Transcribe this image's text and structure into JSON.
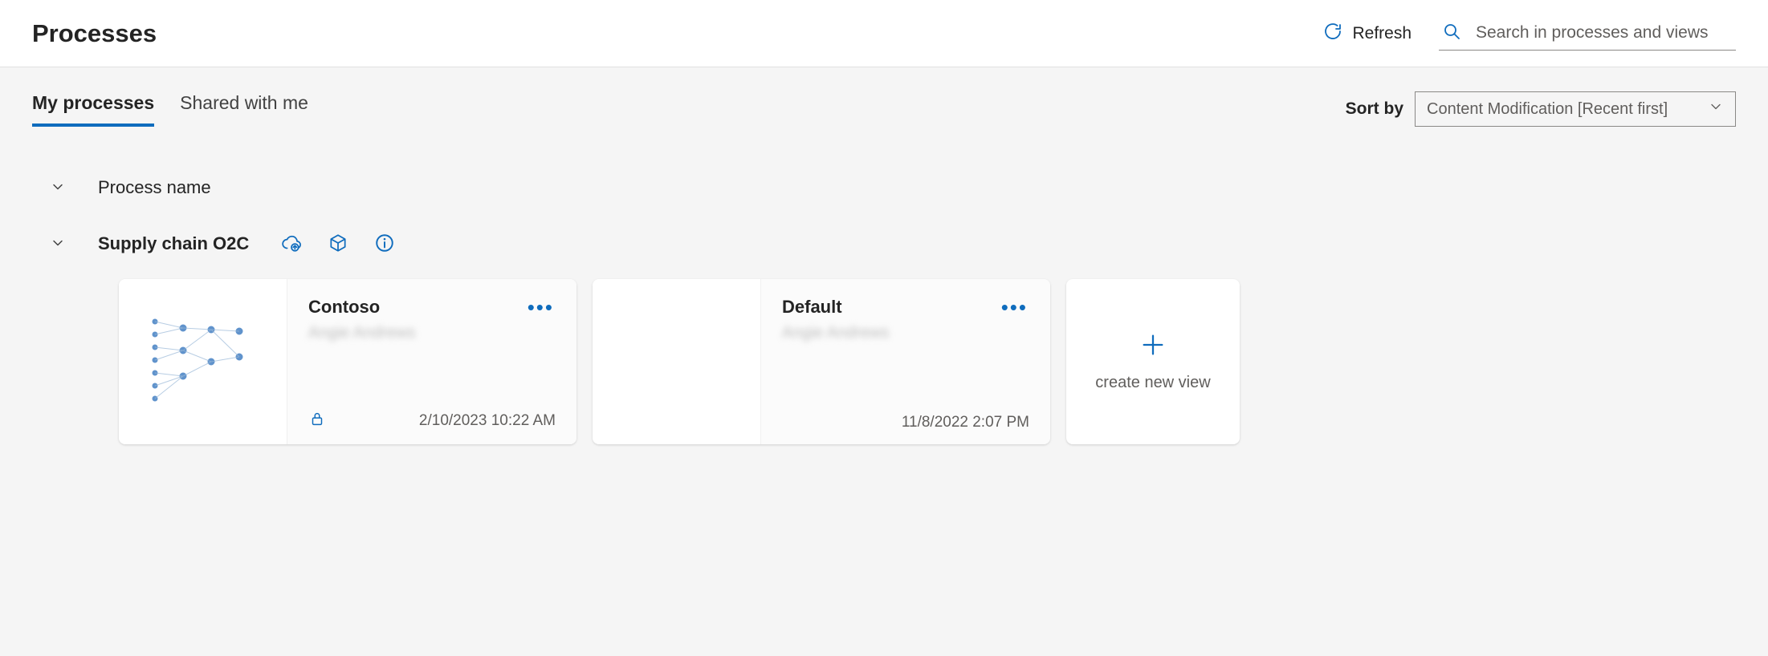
{
  "header": {
    "title": "Processes",
    "refresh_label": "Refresh",
    "search_placeholder": "Search in processes and views"
  },
  "tabs": {
    "my_processes": "My processes",
    "shared_with_me": "Shared with me"
  },
  "sort": {
    "label": "Sort by",
    "selected": "Content Modification [Recent first]"
  },
  "group_header": {
    "process_name_label": "Process name"
  },
  "process": {
    "name": "Supply chain O2C",
    "views": [
      {
        "title": "Contoso",
        "owner": "Angie Andrews",
        "date": "2/10/2023 10:22 AM",
        "locked": true,
        "has_thumb": true
      },
      {
        "title": "Default",
        "owner": "Angie Andrews",
        "date": "11/8/2022 2:07 PM",
        "locked": false,
        "has_thumb": false
      }
    ]
  },
  "create_view_label": "create new view"
}
